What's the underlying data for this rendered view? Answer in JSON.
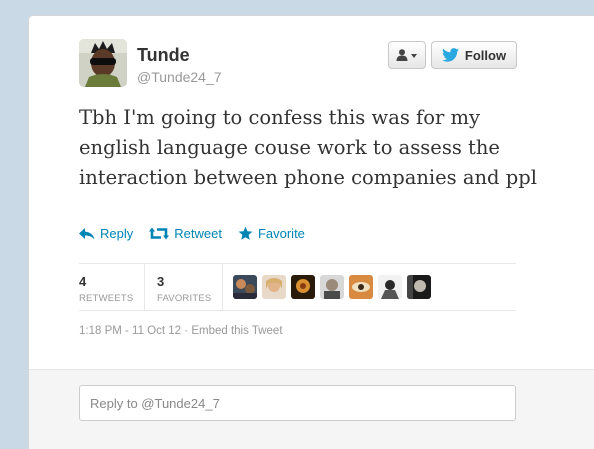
{
  "user": {
    "name": "Tunde",
    "handle": "@Tunde24_7",
    "avatar_icon": "user-avatar-photo"
  },
  "buttons": {
    "user_menu_icon": "person-dropdown-icon",
    "follow_label": "Follow"
  },
  "tweet": {
    "text": "Tbh I'm going to confess this was for my english language couse work to assess the interaction between phone companies and ppl"
  },
  "actions": {
    "reply": "Reply",
    "retweet": "Retweet",
    "favorite": "Favorite"
  },
  "stats": {
    "retweets_count": "4",
    "retweets_label": "RETWEETS",
    "favorites_count": "3",
    "favorites_label": "FAVORITES",
    "favoriter_avatars": [
      "avatar-1",
      "avatar-2",
      "avatar-3",
      "avatar-4",
      "avatar-5",
      "avatar-6",
      "avatar-7"
    ]
  },
  "meta": {
    "timestamp": "1:18 PM - 11 Oct 12",
    "separator": "·",
    "embed": "Embed this Tweet"
  },
  "reply_box": {
    "placeholder": "Reply to @Tunde24_7"
  },
  "colors": {
    "link_blue": "#0084b4",
    "twitter_bird": "#2aa9e0",
    "page_bg": "#c9dae6"
  }
}
